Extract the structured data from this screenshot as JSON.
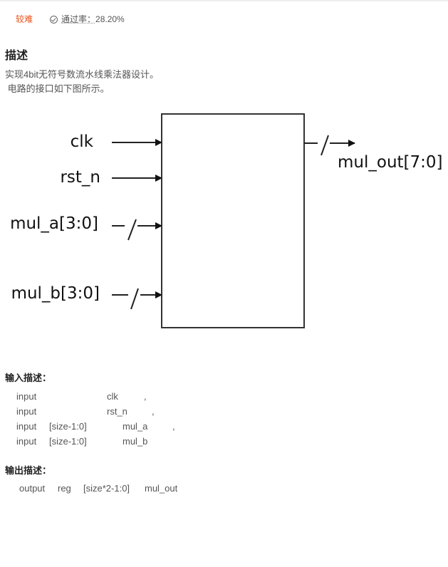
{
  "meta": {
    "difficulty": "较难",
    "difficulty_color": "#e8541c",
    "pass_rate_label": "通过率：",
    "pass_rate_value": "28.20%"
  },
  "description": {
    "title": "描述",
    "lines": [
      "实现4bit无符号数流水线乘法器设计。",
      " 电路的接口如下图所示。"
    ]
  },
  "diagram": {
    "inputs": [
      {
        "label": "clk",
        "bus": false
      },
      {
        "label": "rst_n",
        "bus": false
      },
      {
        "label": "mul_a[3:0]",
        "bus": true
      },
      {
        "label": "mul_b[3:0]",
        "bus": true
      }
    ],
    "outputs": [
      {
        "label": "mul_out[7:0]",
        "bus": true
      }
    ]
  },
  "input_section": {
    "title": "输入描述：",
    "rows": [
      {
        "dir": "input",
        "width": "",
        "name": "clk",
        "sep": ","
      },
      {
        "dir": "input",
        "width": "",
        "name": "rst_n",
        "sep": ","
      },
      {
        "dir": "input",
        "width": "[size-1:0]",
        "name": "mul_a",
        "sep": ","
      },
      {
        "dir": "input",
        "width": "[size-1:0]",
        "name": "mul_b",
        "sep": ""
      }
    ]
  },
  "output_section": {
    "title": "输出描述：",
    "rows": [
      {
        "dir": "output",
        "type": "reg",
        "width": "[size*2-1:0]",
        "name": "mul_out"
      }
    ]
  }
}
